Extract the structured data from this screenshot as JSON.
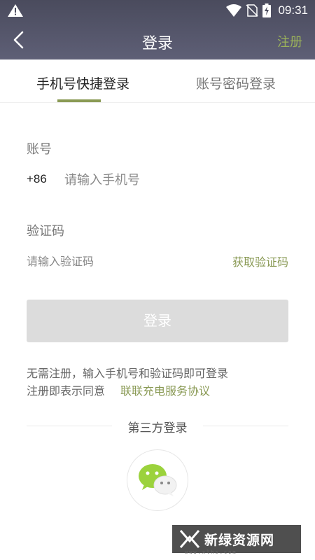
{
  "status_bar": {
    "time": "09:31",
    "icons": [
      "warning-icon",
      "wifi-icon",
      "no-sim-icon",
      "battery-charging-icon"
    ]
  },
  "navbar": {
    "back_icon": "back-arrow-icon",
    "title": "登录",
    "register_label": "注册"
  },
  "tabs": [
    {
      "label": "手机号快捷登录",
      "active": true
    },
    {
      "label": "账号密码登录",
      "active": false
    }
  ],
  "form": {
    "account_label": "账号",
    "country_code": "+86",
    "phone_placeholder": "请输入手机号",
    "code_label": "验证码",
    "code_placeholder": "请输入验证码",
    "get_code_label": "获取验证码",
    "login_button": "登录"
  },
  "hints": {
    "line1": "无需注册，输入手机号和验证码即可登录",
    "line2_prefix": "注册即表示同意",
    "agreement_link": "联联充电服务协议"
  },
  "third_party": {
    "title": "第三方登录",
    "wechat_icon": "wechat-icon"
  },
  "watermark": {
    "text": "新绿资源网",
    "url": "www.xlhs.com"
  },
  "colors": {
    "header_bg": "#4f5064",
    "accent_green": "#8a9a55",
    "register_green": "#9bb25a",
    "disabled_button": "#dcdcdc",
    "wechat_green": "#9bd23c"
  }
}
